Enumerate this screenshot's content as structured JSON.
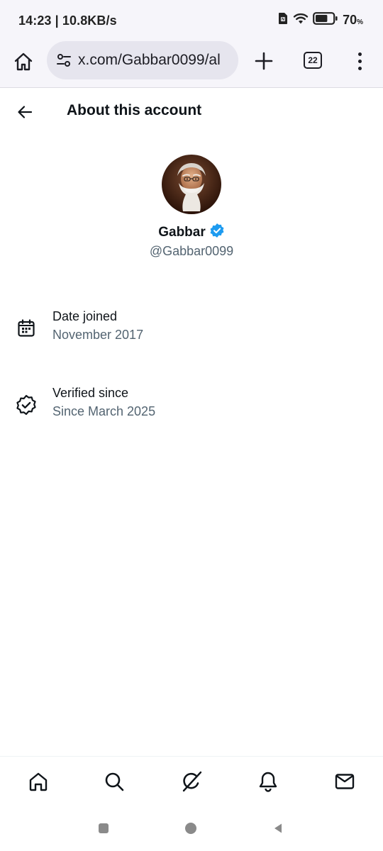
{
  "status_bar": {
    "time_speed": "14:23 | 10.8KB/s",
    "battery_percent": "70",
    "battery_unit": "%",
    "battery_level": 0.7,
    "icons": [
      "sim-icon",
      "wifi-icon",
      "battery-icon"
    ]
  },
  "browser": {
    "url": "x.com/Gabbar0099/al",
    "tab_count": "22",
    "icons": [
      "home-icon",
      "site-settings-icon",
      "new-tab-icon",
      "tabs-icon",
      "more-options-icon"
    ]
  },
  "header": {
    "title": "About this account",
    "back_icon": "arrow-left-icon"
  },
  "profile": {
    "name": "Gabbar",
    "handle": "@Gabbar0099",
    "verified_badge": "verified-badge-icon",
    "verified_color": "#1d9bf0"
  },
  "details": [
    {
      "icon": "calendar-icon",
      "label": "Date joined",
      "value": "November 2017"
    },
    {
      "icon": "verified-outline-icon",
      "label": "Verified since",
      "value": "Since March 2025"
    }
  ],
  "bottom_nav": {
    "items": [
      "home-icon",
      "search-icon",
      "grok-icon",
      "notifications-icon",
      "messages-icon"
    ]
  },
  "system_nav": {
    "items": [
      "recents-button",
      "home-button",
      "back-button"
    ]
  },
  "colors": {
    "text_primary": "#0f1419",
    "text_secondary": "#536471",
    "browser_bg": "#f6f5fa",
    "url_pill_bg": "#e6e5ee"
  }
}
